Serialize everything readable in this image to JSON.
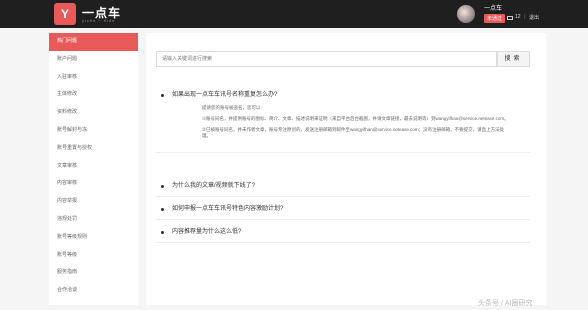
{
  "header": {
    "logo_glyph": "Y",
    "brand": "一点车",
    "brand_sub": "yiche ~ 4ide",
    "user_name": "一点车",
    "user_badge": "未通过",
    "messages": "12",
    "separator": "|",
    "logout": "退出"
  },
  "sidebar": {
    "items": [
      {
        "label": "热门问题",
        "active": true
      },
      {
        "label": "账户问题",
        "active": false
      },
      {
        "label": "入驻审核",
        "active": false
      },
      {
        "label": "主体修改",
        "active": false
      },
      {
        "label": "资料修改",
        "active": false
      },
      {
        "label": "账号解封与冻",
        "active": false
      },
      {
        "label": "账号重置与授权",
        "active": false
      },
      {
        "label": "文章审核",
        "active": false
      },
      {
        "label": "内容审核",
        "active": false
      },
      {
        "label": "内容举报",
        "active": false
      },
      {
        "label": "违规处罚",
        "active": false
      },
      {
        "label": "账号等级规则",
        "active": false
      },
      {
        "label": "账号等级",
        "active": false
      },
      {
        "label": "服务指南",
        "active": false
      },
      {
        "label": "合作洽谈",
        "active": false
      }
    ]
  },
  "search": {
    "placeholder": "请输入关键词进行搜索",
    "button": "搜索"
  },
  "faq": [
    {
      "question": "如果出现一点车车讯号名称重复怎么办?",
      "expanded": true,
      "answer": [
        "提请您的账号被盗名，您可以:",
        "①账号同名，并提供账号的图标、简介、文章、描述说明来证明（来自平台后台截图，并请文章链接，最去说明等）到wangyifhan@service.netease.com。",
        "②已被账号同名，并未作者文章，账号专注原创的，发送注册邮箱到邮件至wangyifhan@service.netease.com；没有注册邮箱，不要提交，请直上方法处理。"
      ]
    },
    {
      "question": "为什么我的文章/视频就下线了?",
      "expanded": false,
      "answer": []
    },
    {
      "question": "如何申报一点车车讯号特色内容激励计划?",
      "expanded": false,
      "answer": []
    },
    {
      "question": "内容推荐量为什么这么低?",
      "expanded": false,
      "answer": []
    }
  ],
  "watermark": "头条号 / AI圈研究"
}
